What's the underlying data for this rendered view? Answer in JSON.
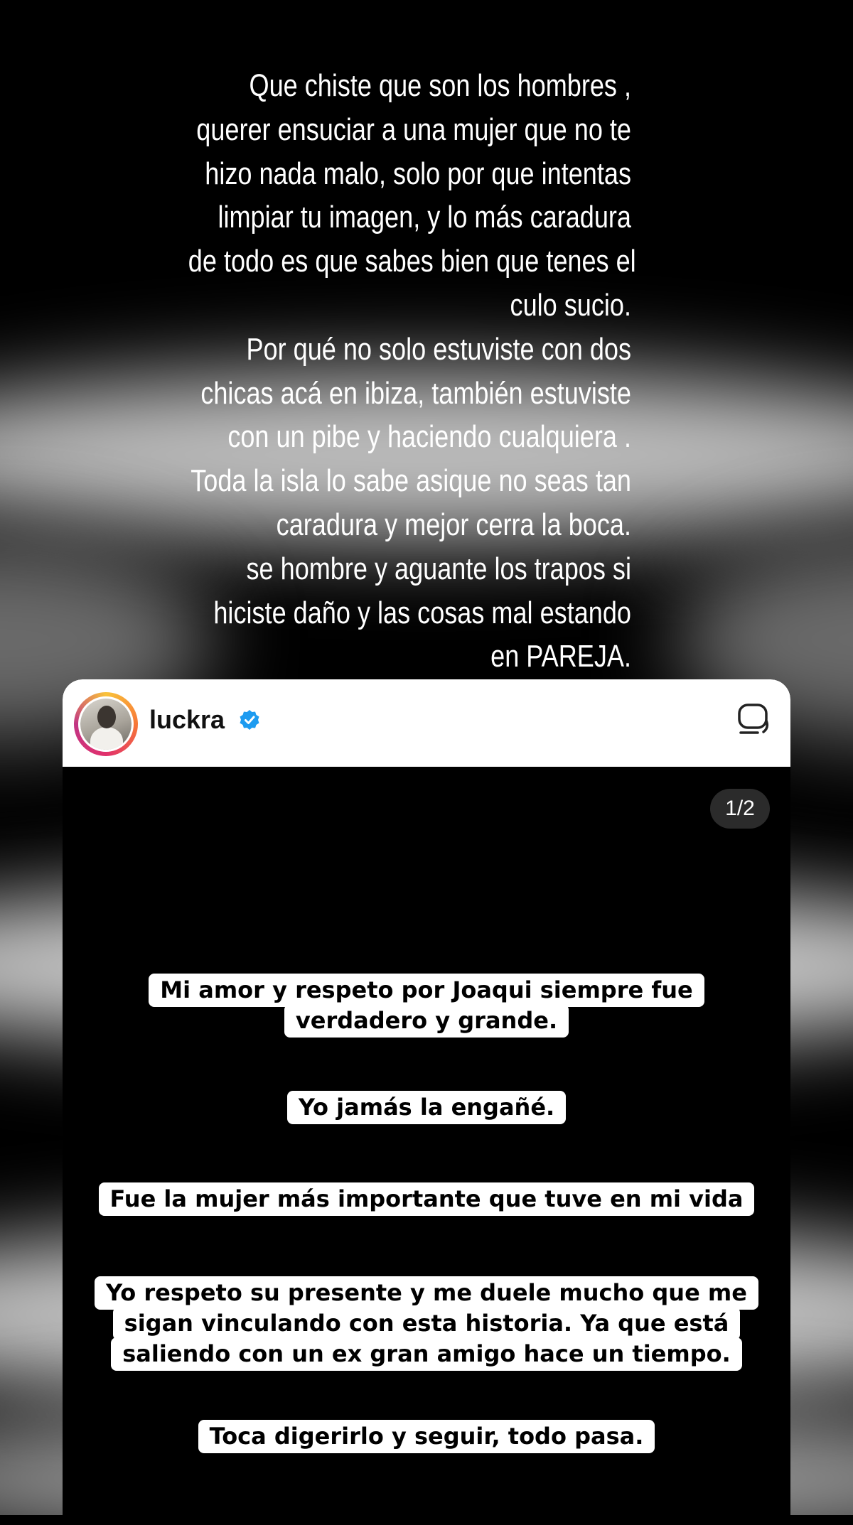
{
  "story": {
    "text_lines": [
      "Que  chiste que son los hombres ,",
      "querer ensuciar a una mujer que no te",
      "hizo nada malo, solo por que intentas",
      "limpiar tu imagen, y lo más caradura",
      "de todo es que sabes bien que tenes el",
      "culo sucio.",
      "Por qué no solo estuviste con dos",
      "chicas acá en ibiza, también estuviste",
      "con un pibe y haciendo cualquiera .",
      "Toda la isla lo sabe asique no seas tan",
      "caradura y mejor cerra la boca.",
      "se hombre y aguante los trapos si",
      "hiciste daño y las cosas mal estando",
      "en PAREJA."
    ]
  },
  "post": {
    "username": "luckra",
    "verified": true,
    "avatar_icon": "profile-photo",
    "more_icon": "message-bubble-icon",
    "counter": "1/2",
    "messages": [
      [
        "Mi amor y respeto por Joaqui siempre fue",
        "verdadero y grande."
      ],
      [
        "Yo jamás la engañé."
      ],
      [
        "Fue la mujer más importante que tuve en mi vida"
      ],
      [
        "Yo respeto su presente y me duele mucho que me",
        "sigan vinculando  con esta historia. Ya que está",
        "saliendo con un ex gran amigo hace un tiempo."
      ],
      [
        "Toca digerirlo y seguir, todo pasa."
      ]
    ]
  },
  "colors": {
    "background": "#000000",
    "text": "#ffffff",
    "verified_badge": "#1d9bf0",
    "message_background": "#ffffff"
  }
}
